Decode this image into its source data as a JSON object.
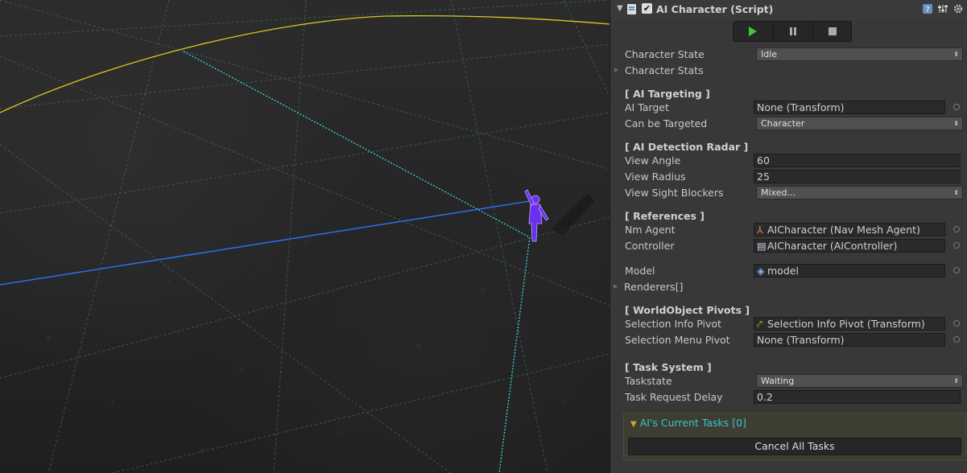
{
  "component": {
    "title": "AI Character (Script)",
    "enabled": true
  },
  "fields": {
    "character_state": {
      "label": "Character State",
      "value": "Idle"
    },
    "character_stats": {
      "label": "Character Stats"
    },
    "ai_targeting": {
      "header": "[ AI Targeting ]"
    },
    "ai_target": {
      "label": "AI Target",
      "value": "None (Transform)"
    },
    "can_be_targeted": {
      "label": "Can be Targeted",
      "value": "Character"
    },
    "ai_detection_radar": {
      "header": "[ AI Detection Radar ]"
    },
    "view_angle": {
      "label": "View Angle",
      "value": "60"
    },
    "view_radius": {
      "label": "View Radius",
      "value": "25"
    },
    "view_sight_blockers": {
      "label": "View Sight Blockers",
      "value": "Mixed..."
    },
    "references": {
      "header": "[ References ]"
    },
    "nm_agent": {
      "label": "Nm Agent",
      "value": "AICharacter (Nav Mesh Agent)"
    },
    "controller": {
      "label": "Controller",
      "value": "AICharacter (AIController)"
    },
    "model": {
      "label": "Model",
      "value": "model"
    },
    "renderers": {
      "label": "Renderers[]"
    },
    "worldobject_pivots": {
      "header": "[ WorldObject Pivots ]"
    },
    "selection_info_pivot": {
      "label": "Selection Info Pivot",
      "value": "Selection Info Pivot (Transform)"
    },
    "selection_menu_pivot": {
      "label": "Selection Menu Pivot",
      "value": "None (Transform)"
    },
    "task_system": {
      "header": "[ Task System ]"
    },
    "taskstate": {
      "label": "Taskstate",
      "value": "Waiting"
    },
    "task_request_delay": {
      "label": "Task Request Delay",
      "value": "0.2"
    }
  },
  "tasks": {
    "title": "AI's Current Tasks [0]",
    "cancel_label": "Cancel All Tasks"
  },
  "colors": {
    "play": "#3cc83c",
    "view_cone": "#38d8e0",
    "target_line": "#2a6ff0",
    "radius_arc": "#d8c820",
    "character": "#6b2ff0",
    "tasks_title": "#38c8c8"
  },
  "icons": [
    "help-icon",
    "preset-icon",
    "gear-icon",
    "play-icon",
    "pause-icon",
    "stop-icon"
  ]
}
